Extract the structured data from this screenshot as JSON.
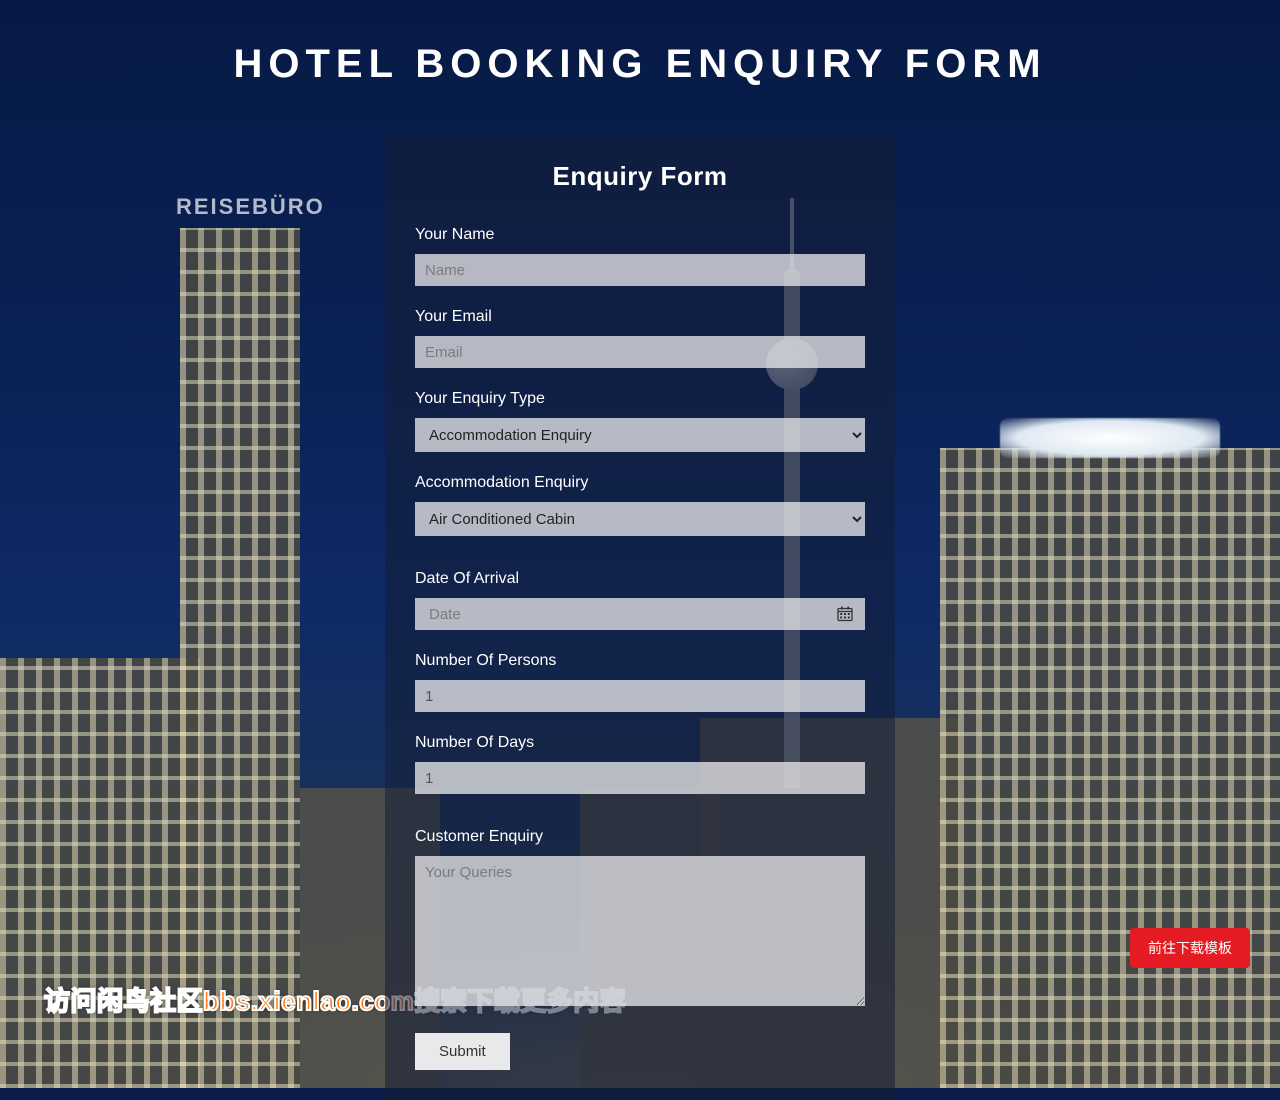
{
  "page": {
    "title": "HOTEL BOOKING ENQUIRY FORM"
  },
  "card": {
    "heading": "Enquiry Form"
  },
  "form": {
    "name": {
      "label": "Your Name",
      "placeholder": "Name"
    },
    "email": {
      "label": "Your Email",
      "placeholder": "Email"
    },
    "enquiry_type": {
      "label": "Your Enquiry Type",
      "selected": "Accommodation Enquiry"
    },
    "accommodation": {
      "label": "Accommodation Enquiry",
      "selected": "Air Conditioned Cabin"
    },
    "arrival": {
      "label": "Date Of Arrival",
      "placeholder": "Date"
    },
    "persons": {
      "label": "Number Of Persons",
      "value": "1"
    },
    "days": {
      "label": "Number Of Days",
      "value": "1"
    },
    "customer_enquiry": {
      "label": "Customer Enquiry",
      "placeholder": "Your Queries"
    },
    "submit_label": "Submit"
  },
  "download_button": "前往下载模板",
  "watermark": "访问闲鸟社区bbs.xienlao.com搜索下载更多内容"
}
